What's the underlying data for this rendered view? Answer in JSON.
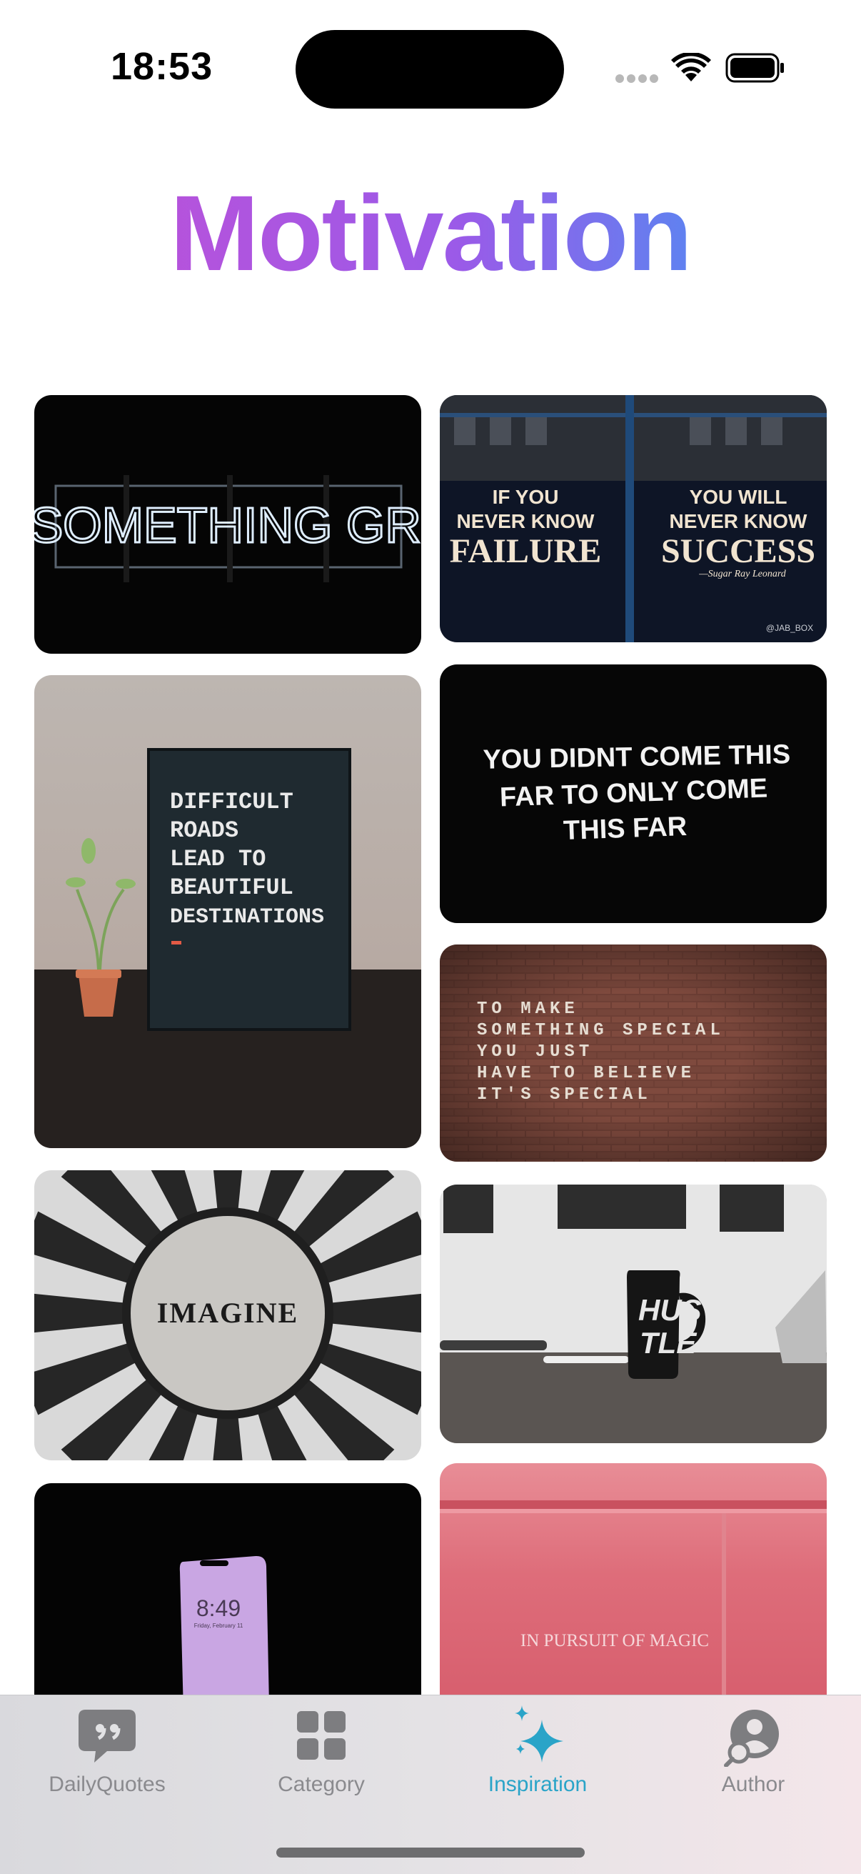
{
  "status_bar": {
    "time": "18:53"
  },
  "page": {
    "title": "Motivation"
  },
  "colors": {
    "title_gradient_start": "#b553dc",
    "title_gradient_end": "#5f82f0",
    "tab_active": "#2aa4c8",
    "tab_inactive": "#8a8a8e"
  },
  "gallery": [
    {
      "name": "neon-sign-image",
      "text": "DO SOMETHING GREAT"
    },
    {
      "name": "window-quote-image",
      "left_top": "IF YOU",
      "left_mid": "NEVER KNOW",
      "left_big": "FAILURE",
      "right_top": "YOU WILL",
      "right_mid": "NEVER KNOW",
      "right_big": "SUCCESS",
      "signature": "—Sugar Ray Leonard",
      "tag": "@JAB_BOX"
    },
    {
      "name": "letterboard-image",
      "lines": [
        "DIFFICULT",
        "ROADS",
        "LEAD TO",
        "BEAUTIFUL",
        "DESTINATIONS"
      ]
    },
    {
      "name": "black-quote-image",
      "lines": [
        "YOU DIDNT COME THIS",
        "FAR TO ONLY COME",
        "THIS FAR"
      ]
    },
    {
      "name": "brick-wall-image",
      "lines": [
        "TO MAKE",
        "SOMETHING SPECIAL",
        "YOU JUST",
        "HAVE TO BELIEVE",
        "IT'S SPECIAL"
      ]
    },
    {
      "name": "mosaic-image",
      "text": "IMAGINE"
    },
    {
      "name": "mug-image",
      "lines": [
        "HUS",
        "TLE"
      ]
    },
    {
      "name": "phone-image",
      "time": "8:49",
      "date": "Friday, February 11"
    },
    {
      "name": "pink-wall-image",
      "text": "IN PURSUIT OF MAGIC"
    }
  ],
  "tabs": [
    {
      "label": "DailyQuotes",
      "icon": "quote-bubble-icon",
      "active": false
    },
    {
      "label": "Category",
      "icon": "grid-icon",
      "active": false
    },
    {
      "label": "Inspiration",
      "icon": "sparkles-icon",
      "active": true
    },
    {
      "label": "Author",
      "icon": "person-search-icon",
      "active": false
    }
  ]
}
